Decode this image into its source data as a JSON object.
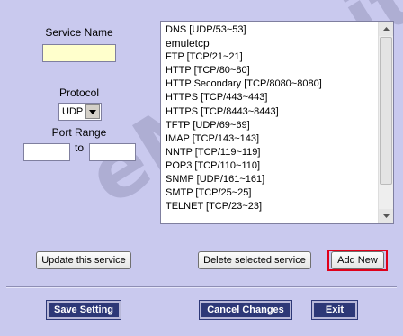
{
  "form": {
    "service_name_label": "Service Name",
    "service_name_value": "",
    "protocol_label": "Protocol",
    "protocol_value": "UDP",
    "port_range_label": "Port Range",
    "port_to_label": "to",
    "port_from_value": "",
    "port_to_value": ""
  },
  "services": [
    "DNS [UDP/53~53]",
    "emuletcp",
    "FTP [TCP/21~21]",
    "HTTP [TCP/80~80]",
    "HTTP Secondary [TCP/8080~8080]",
    "HTTPS [TCP/443~443]",
    "HTTPS [TCP/8443~8443]",
    "TFTP [UDP/69~69]",
    "IMAP [TCP/143~143]",
    "NNTP [TCP/119~119]",
    "POP3 [TCP/110~110]",
    "SNMP [UDP/161~161]",
    "SMTP [TCP/25~25]",
    "TELNET [TCP/23~23]"
  ],
  "buttons": {
    "update": "Update this service",
    "delete": "Delete selected service",
    "add_new": "Add New",
    "save": "Save Setting",
    "cancel": "Cancel Changes",
    "exit": "Exit"
  },
  "watermark": "eMule.it",
  "colors": {
    "background": "#c9c9ee",
    "dark_button": "#2d3877",
    "highlight_frame": "#e0001a",
    "input_highlight": "#ffffcc"
  }
}
